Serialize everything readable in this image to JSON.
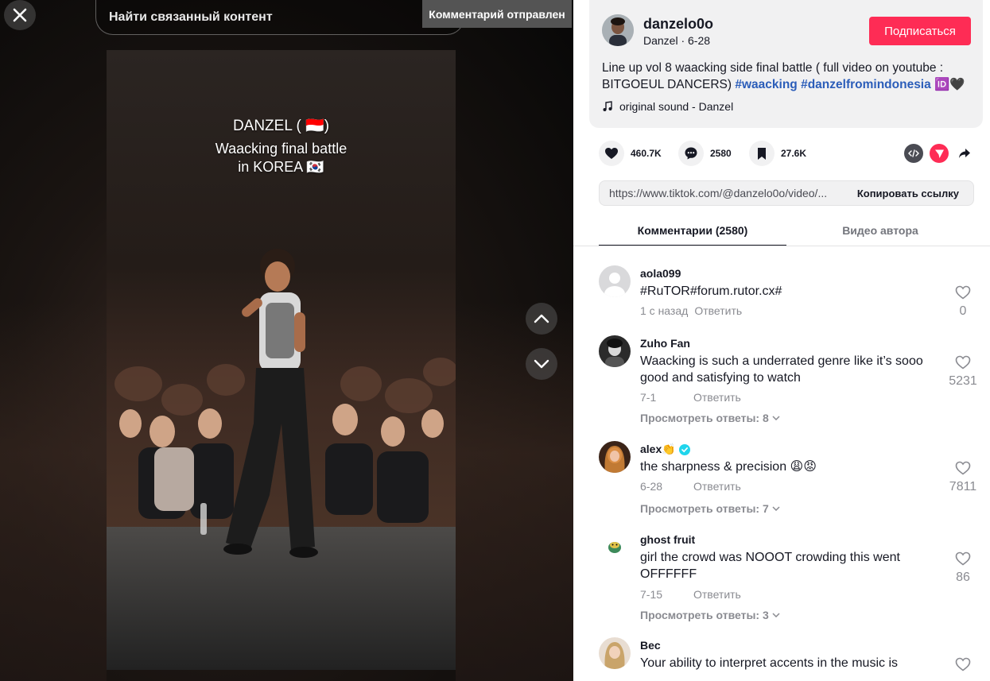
{
  "top": {
    "search_placeholder": "Найти связанный контент",
    "toast": "Комментарий отправлен"
  },
  "video": {
    "overlay_line1": "DANZEL ( 🇮🇩)",
    "overlay_line2": "Waacking final battle",
    "overlay_line3": "in KOREA 🇰🇷"
  },
  "author": {
    "username": "danzelo0o",
    "nickname_date": "Danzel · 6-28",
    "follow_label": "Подписаться"
  },
  "description": {
    "text": "Line up vol 8 waacking side final battle ( full video on youtube : BITGOEUL DANCERS) ",
    "hashtag1": "#waacking",
    "hashtag2": "#danzelfromindonesia",
    "suffix": " 🆔🖤",
    "music": "original sound - Danzel"
  },
  "stats": {
    "likes": "460.7K",
    "comments": "2580",
    "saves": "27.6K"
  },
  "link": {
    "url": "https://www.tiktok.com/@danzelo0o/video/...",
    "copy_label": "Копировать ссылку"
  },
  "tabs": {
    "comments": "Комментарии (2580)",
    "author_videos": "Видео автора"
  },
  "comments": [
    {
      "user": "aola099",
      "text": "#RuTOR#forum.rutor.cx#",
      "date": "1 с назад",
      "reply": "Ответить",
      "likes": "0",
      "view_replies": ""
    },
    {
      "user": "Zuho Fan",
      "text": "Waacking is such a underrated genre like it’s sooo good and satisfying to watch",
      "date": "7-1",
      "reply": "Ответить",
      "likes": "5231",
      "view_replies": "Просмотреть ответы: 8"
    },
    {
      "user": "alex👏",
      "text": "the sharpness & precision 😩😡",
      "date": "6-28",
      "reply": "Ответить",
      "likes": "7811",
      "view_replies": "Просмотреть ответы: 7"
    },
    {
      "user": "ghost fruit",
      "text": "girl the crowd was NOOOT crowding this went OFFFFFF",
      "date": "7-15",
      "reply": "Ответить",
      "likes": "86",
      "view_replies": "Просмотреть ответы: 3"
    },
    {
      "user": "Bec",
      "text": "Your ability to interpret accents in the music is",
      "date": "",
      "reply": "",
      "likes": "",
      "view_replies": ""
    }
  ],
  "colors": {
    "accent": "#fe2c55",
    "hashtag": "#2b5db9",
    "verified": "#20d5ec"
  }
}
